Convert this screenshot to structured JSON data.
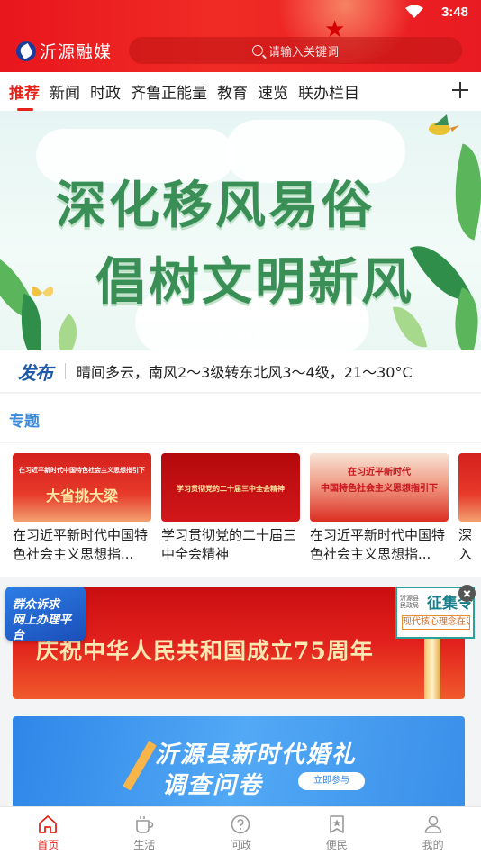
{
  "status_bar": {
    "time": "3:48"
  },
  "header": {
    "app_name": "沂源融媒",
    "search_placeholder": "请输入关键词"
  },
  "tabs": [
    {
      "label": "推荐",
      "active": true
    },
    {
      "label": "新闻"
    },
    {
      "label": "时政"
    },
    {
      "label": "齐鲁正能量"
    },
    {
      "label": "教育"
    },
    {
      "label": "速览"
    },
    {
      "label": "联办栏目"
    }
  ],
  "banner": {
    "line1": "深化移风易俗",
    "line2": "倡树文明新风",
    "slides": 5,
    "active_slide": 1
  },
  "weather": {
    "source": "发布",
    "text": "晴间多云，南风2～3级转东北风3～4级，21～30°C"
  },
  "topics": {
    "title": "专题",
    "cards": [
      {
        "image_caption_small": "在习近平新时代中国特色社会主义思想指引下",
        "image_caption_big": "大省挑大梁",
        "title": "在习近平新时代中国特色社会主义思想指..."
      },
      {
        "image_caption_big": "学习贯彻党的二十届三中全会精神",
        "title": "学习贯彻党的二十届三中全会精神"
      },
      {
        "image_caption_small": "在习近平新时代",
        "image_caption_big": "中国特色社会主义思想指引下",
        "title": "在习近平新时代中国特色社会主义思想指..."
      },
      {
        "title": "深入的二"
      }
    ]
  },
  "promo": {
    "red_banner_text": "庆祝中华人民共和国成立75周年",
    "float_left": "群众诉求\n网上办理平台",
    "float_right_top": "征集令",
    "float_right_small": "沂源县 民政局",
    "float_right_bottom": "现代核心理念在沂源",
    "blue_line1": "沂源县新时代婚礼",
    "blue_line2": "调查问卷",
    "blue_button": "立即参与"
  },
  "bottom_nav": [
    {
      "label": "首页",
      "icon": "home-icon",
      "active": true
    },
    {
      "label": "生活",
      "icon": "cup-icon"
    },
    {
      "label": "问政",
      "icon": "question-icon"
    },
    {
      "label": "便民",
      "icon": "star-bookmark-icon"
    },
    {
      "label": "我的",
      "icon": "user-icon"
    }
  ],
  "colors": {
    "brand_red": "#e5231a",
    "topic_blue": "#3a8ad8",
    "banner_green": "#3a8f56"
  }
}
